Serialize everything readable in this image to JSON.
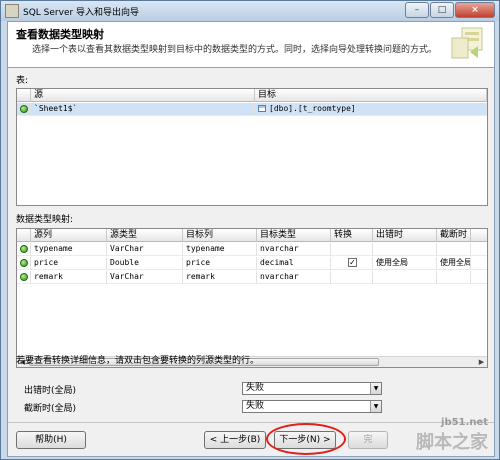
{
  "window": {
    "title": "SQL Server 导入和导出向导",
    "buttons": [
      "–",
      "□",
      "×"
    ]
  },
  "header": {
    "title": "查看数据类型映射",
    "description": "选择一个表以查看其数据类型映射到目标中的数据类型的方式。同时，选择向导处理转换问题的方式。"
  },
  "tables_section": {
    "label": "表:",
    "columns": [
      "源",
      "目标"
    ],
    "rows": [
      {
        "status_icon": "ok-icon",
        "source": "`Sheet1$`",
        "target": "[dbo].[t_roomtype]"
      }
    ]
  },
  "mapping_section": {
    "label": "数据类型映射:",
    "columns": [
      "源列",
      "源类型",
      "目标列",
      "目标类型",
      "转换",
      "出错时",
      "截断时"
    ],
    "rows": [
      {
        "source_col": "typename",
        "source_type": "VarChar",
        "target_col": "typename",
        "target_type": "nvarchar",
        "convert": "",
        "on_error": "",
        "on_truncate": ""
      },
      {
        "source_col": "price",
        "source_type": "Double",
        "target_col": "price",
        "target_type": "decimal",
        "convert": "checked",
        "on_error": "使用全局",
        "on_truncate": "使用全局"
      },
      {
        "source_col": "remark",
        "source_type": "VarChar",
        "target_col": "remark",
        "target_type": "nvarchar",
        "convert": "",
        "on_error": "",
        "on_truncate": ""
      }
    ],
    "hint": "若要查看转换详细信息，请双击包含要转换的列源类型的行。"
  },
  "global_options": {
    "on_error_label": "出错时(全局)",
    "on_error_value": "失败",
    "on_truncate_label": "截断时(全局)",
    "on_truncate_value": "失败"
  },
  "buttons": {
    "help": "帮助(H)",
    "back": "< 上一步(B)",
    "next": "下一步(N) >",
    "finish": "完"
  },
  "watermark": {
    "site": "jb51.net",
    "name": "脚本之家"
  }
}
